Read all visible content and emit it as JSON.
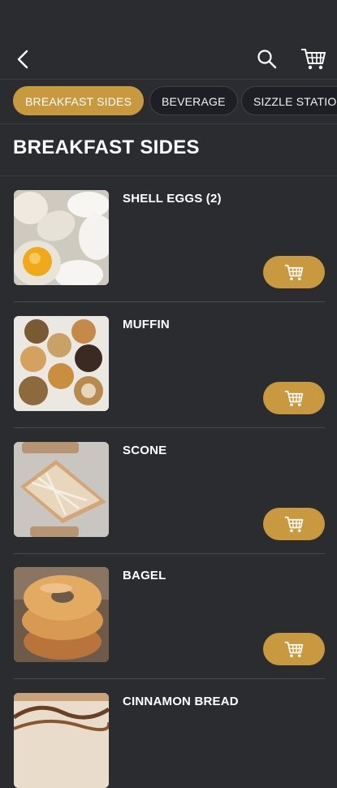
{
  "header": {
    "back_icon": "back-chevron-icon",
    "search_icon": "search-icon",
    "cart_icon": "cart-icon"
  },
  "tabs": [
    {
      "label": "BREAKFAST SIDES",
      "active": true
    },
    {
      "label": "BEVERAGE",
      "active": false
    },
    {
      "label": "SIZZLE STATION",
      "active": false
    }
  ],
  "section": {
    "title": "BREAKFAST SIDES"
  },
  "items": [
    {
      "name": "SHELL EGGS (2)"
    },
    {
      "name": "MUFFIN"
    },
    {
      "name": "SCONE"
    },
    {
      "name": "BAGEL"
    },
    {
      "name": "CINNAMON BREAD"
    }
  ],
  "colors": {
    "accent": "#c8993f",
    "background": "#2b2c30",
    "chip": "#1d1f24"
  }
}
